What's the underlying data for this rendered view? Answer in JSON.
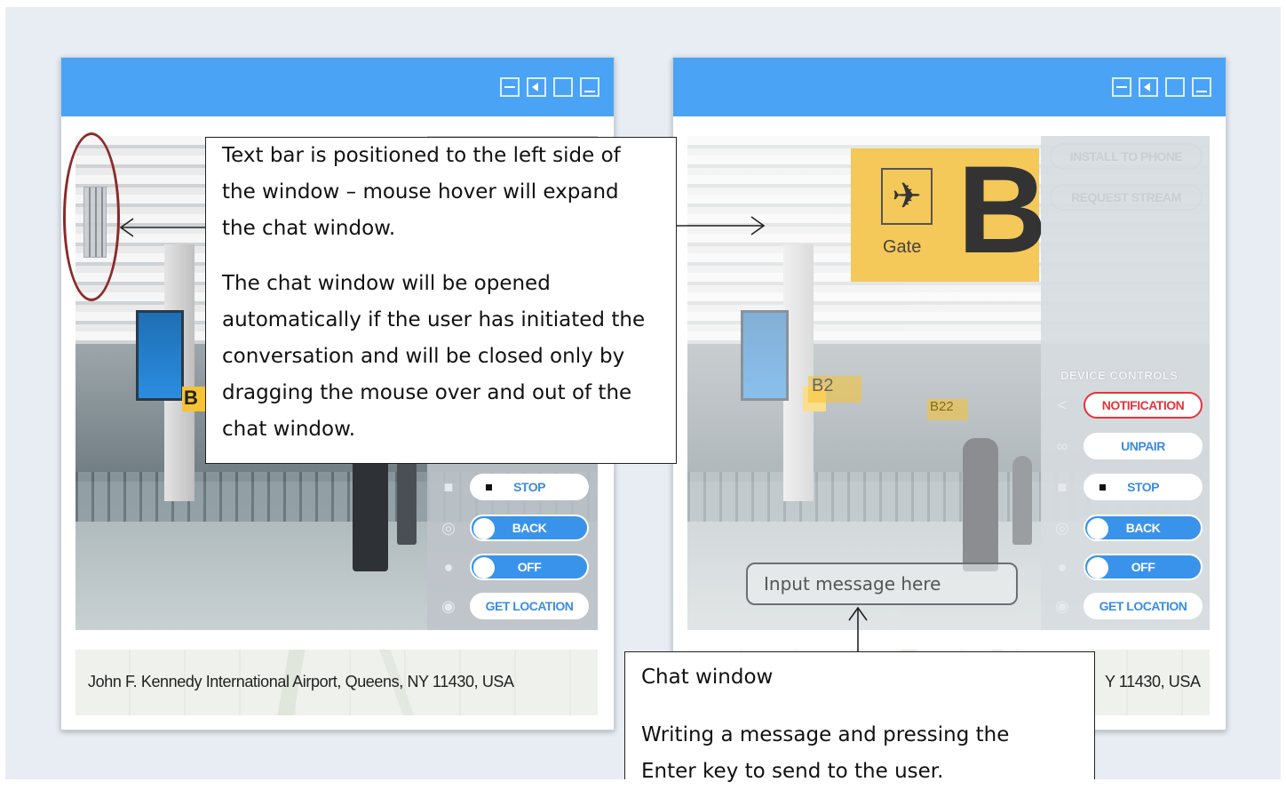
{
  "left_window": {
    "address": "John F. Kennedy International Airport, Queens, NY 11430, USA",
    "controls": {
      "stop": "STOP",
      "back": "BACK",
      "off": "OFF",
      "get_location": "GET LOCATION"
    },
    "scene_text": {
      "gate_sign": "B"
    }
  },
  "right_window": {
    "address_partial": "Y 11430, USA",
    "sign": {
      "label": "Gate",
      "letter": "B"
    },
    "panel_buttons": {
      "install": "INSTALL TO PHONE",
      "request": "REQUEST STREAM"
    },
    "device_controls_label": "DEVICE CONTROLS",
    "controls": {
      "notification": "NOTIFICATION",
      "unpair": "UNPAIR",
      "stop": "STOP",
      "back": "BACK",
      "off": "OFF",
      "get_location": "GET LOCATION"
    },
    "scene_text": {
      "gate_b2": "B2",
      "gate_b22": "B22"
    },
    "chat_input_placeholder": "Input message here"
  },
  "callouts": {
    "text_bar": {
      "paragraph1": "Text bar is positioned to the left side of the window – mouse hover will expand the chat window.",
      "paragraph2": "The chat window will be opened automatically if the user has initiated the conversation and will be closed only by dragging the mouse over and out of the chat window."
    },
    "chat_window": {
      "title": "Chat window",
      "body": "Writing a message and pressing the Enter key to send to the user."
    }
  },
  "colors": {
    "titlebar": "#4aa3f5",
    "toggle_blue": "#3a93ea",
    "notification_red": "#e8323c",
    "annotation_oval": "#8b2a2a",
    "gate_sign": "#f7c331"
  }
}
